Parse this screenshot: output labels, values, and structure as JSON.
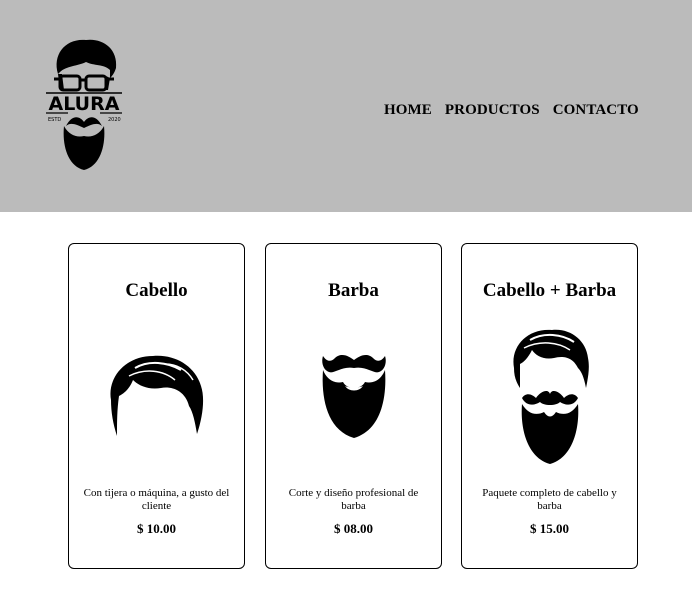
{
  "header": {
    "logo": {
      "brand": "ALURA",
      "estd": "ESTD",
      "year": "2020"
    },
    "nav": [
      "HOME",
      "PRODUCTOS",
      "CONTACTO"
    ]
  },
  "products": [
    {
      "title": "Cabello",
      "icon": "hair-icon",
      "description": "Con tijera o máquina, a gusto del cliente",
      "price": "$ 10.00"
    },
    {
      "title": "Barba",
      "icon": "beard-icon",
      "description": "Corte y diseño profesional de barba",
      "price": "$ 08.00"
    },
    {
      "title": "Cabello + Barba",
      "icon": "hair-and-beard-icon",
      "description": "Paquete completo de cabello y barba",
      "price": "$ 15.00"
    }
  ]
}
